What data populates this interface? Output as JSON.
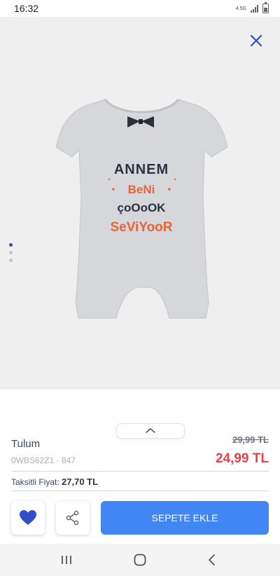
{
  "status_bar": {
    "time": "16:32",
    "network": "4.5G",
    "icons": [
      "network-type-icon",
      "signal-icon",
      "battery-icon"
    ]
  },
  "gallery": {
    "close_icon": "close-icon",
    "image_count": 3,
    "active_index": 0,
    "print_lines": [
      "ANNEM",
      "BeNi",
      "çoOoOK",
      "SeViYooR"
    ]
  },
  "product": {
    "name": "Tulum",
    "code": "0WBS62Z1 - 847",
    "old_price": "29,99 TL",
    "new_price": "24,99 TL",
    "installment_label": "Taksitli Fiyat:",
    "installment_price": "27,70 TL"
  },
  "actions": {
    "favorite_icon": "heart-icon",
    "share_icon": "share-icon",
    "add_to_cart_label": "SEPETE EKLE"
  },
  "nav": [
    "recent-apps-icon",
    "home-icon",
    "back-icon"
  ],
  "colors": {
    "accent": "#4285f4",
    "price_red": "#ef3e4a",
    "favorite_blue": "#2d4fc7",
    "image_bg": "#efefef"
  }
}
